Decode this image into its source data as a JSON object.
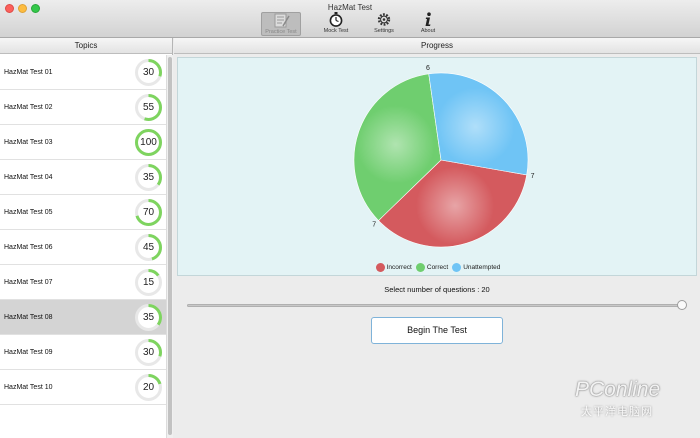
{
  "window": {
    "title": "HazMat Test"
  },
  "toolbar": {
    "items": [
      {
        "label": "Practice Test",
        "icon": "practice-test-icon",
        "active": true
      },
      {
        "label": "Mock Test",
        "icon": "stopwatch-icon",
        "active": false
      },
      {
        "label": "Settings",
        "icon": "gear-icon",
        "active": false
      },
      {
        "label": "About",
        "icon": "info-icon",
        "active": false
      }
    ]
  },
  "topics": {
    "header": "Topics",
    "items": [
      {
        "name": "HazMat Test 01",
        "percent": 30,
        "selected": false
      },
      {
        "name": "HazMat Test 02",
        "percent": 55,
        "selected": false
      },
      {
        "name": "HazMat Test 03",
        "percent": 100,
        "selected": false
      },
      {
        "name": "HazMat Test 04",
        "percent": 35,
        "selected": false
      },
      {
        "name": "HazMat Test 05",
        "percent": 70,
        "selected": false
      },
      {
        "name": "HazMat Test 06",
        "percent": 45,
        "selected": false
      },
      {
        "name": "HazMat Test 07",
        "percent": 15,
        "selected": false
      },
      {
        "name": "HazMat Test 08",
        "percent": 35,
        "selected": true
      },
      {
        "name": "HazMat Test 09",
        "percent": 30,
        "selected": false
      },
      {
        "name": "HazMat Test 10",
        "percent": 20,
        "selected": false
      }
    ]
  },
  "progress": {
    "header": "Progress",
    "chart_data": {
      "type": "pie",
      "categories": [
        "Incorrect",
        "Correct",
        "Unattempted"
      ],
      "values": [
        7,
        7,
        6
      ],
      "colors": [
        "#d45a5e",
        "#6fce6f",
        "#6fc4f5"
      ],
      "legend_position": "bottom-center"
    },
    "question_label": "Select number of questions : 20",
    "question_count": 20,
    "question_count_max": 20,
    "begin_label": "Begin The Test"
  },
  "colors": {
    "ring_fill": "#7ed45f",
    "ring_track": "#e8e8e8"
  },
  "watermark": {
    "main": "PConline",
    "sub": "太平洋电脑网"
  }
}
